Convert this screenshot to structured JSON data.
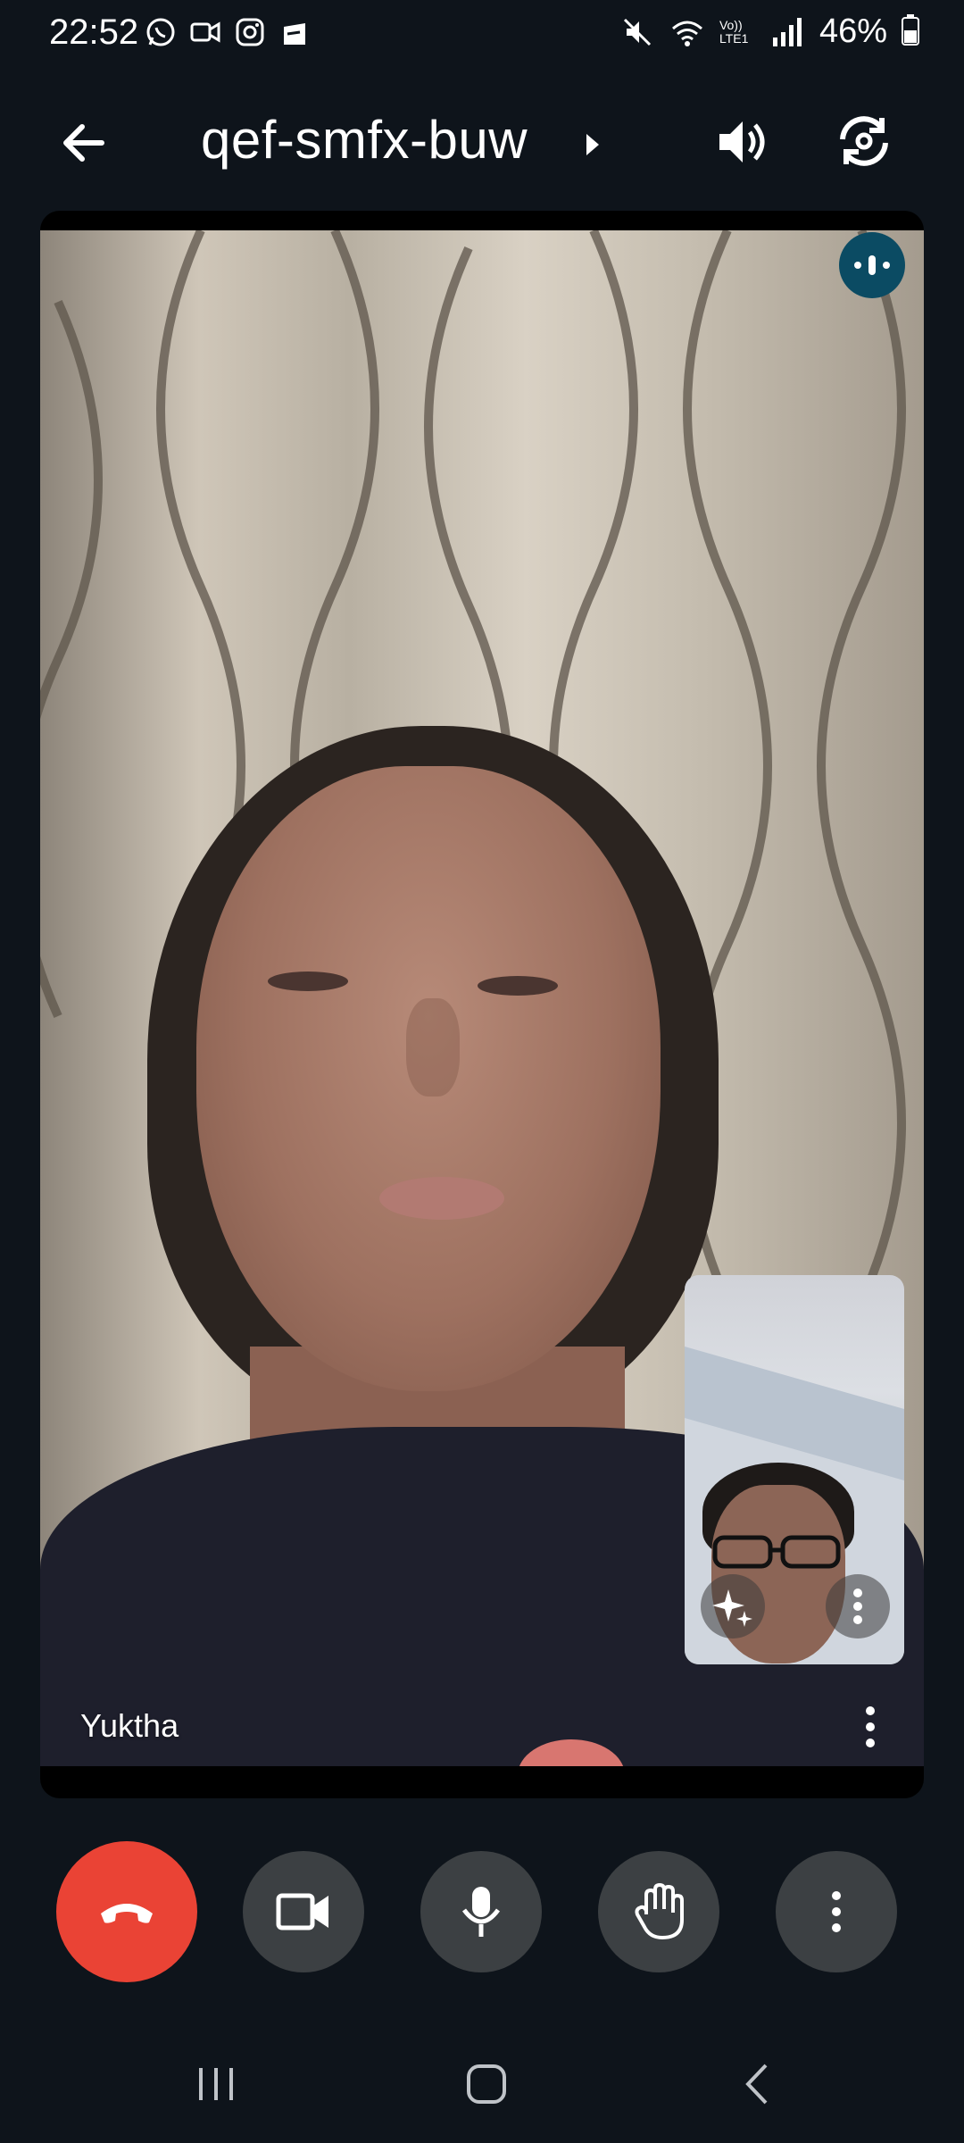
{
  "status_bar": {
    "time": "22:52",
    "left_icons": [
      "whatsapp-icon",
      "meet-video-icon",
      "instagram-icon",
      "shopping-icon"
    ],
    "right_icons": [
      "mute-icon",
      "wifi-icon",
      "volte-icon",
      "signal-icon",
      "battery-icon"
    ],
    "volte_label": "Vo)) LTE1",
    "battery_percent": "46%"
  },
  "header": {
    "meeting_code": "qef-smfx-buw",
    "icons": [
      "back-arrow-icon",
      "chevron-right-icon",
      "speaker-icon",
      "switch-camera-icon"
    ]
  },
  "main_video": {
    "participant_name": "Yuktha",
    "audio_indicator_icon": "audio-level-icon",
    "more_icon": "more-vertical-icon"
  },
  "self_view": {
    "effects_icon": "sparkles-icon",
    "more_icon": "more-vertical-icon"
  },
  "controls": {
    "buttons": [
      "end-call",
      "camera",
      "microphone",
      "raise-hand",
      "more-options"
    ],
    "end_call_color": "#ea4335",
    "button_color": "#3c4043"
  },
  "nav_bar": {
    "buttons": [
      "recents",
      "home",
      "back"
    ]
  },
  "colors": {
    "background": "#0e141b",
    "audio_indicator": "#0b4b63"
  }
}
